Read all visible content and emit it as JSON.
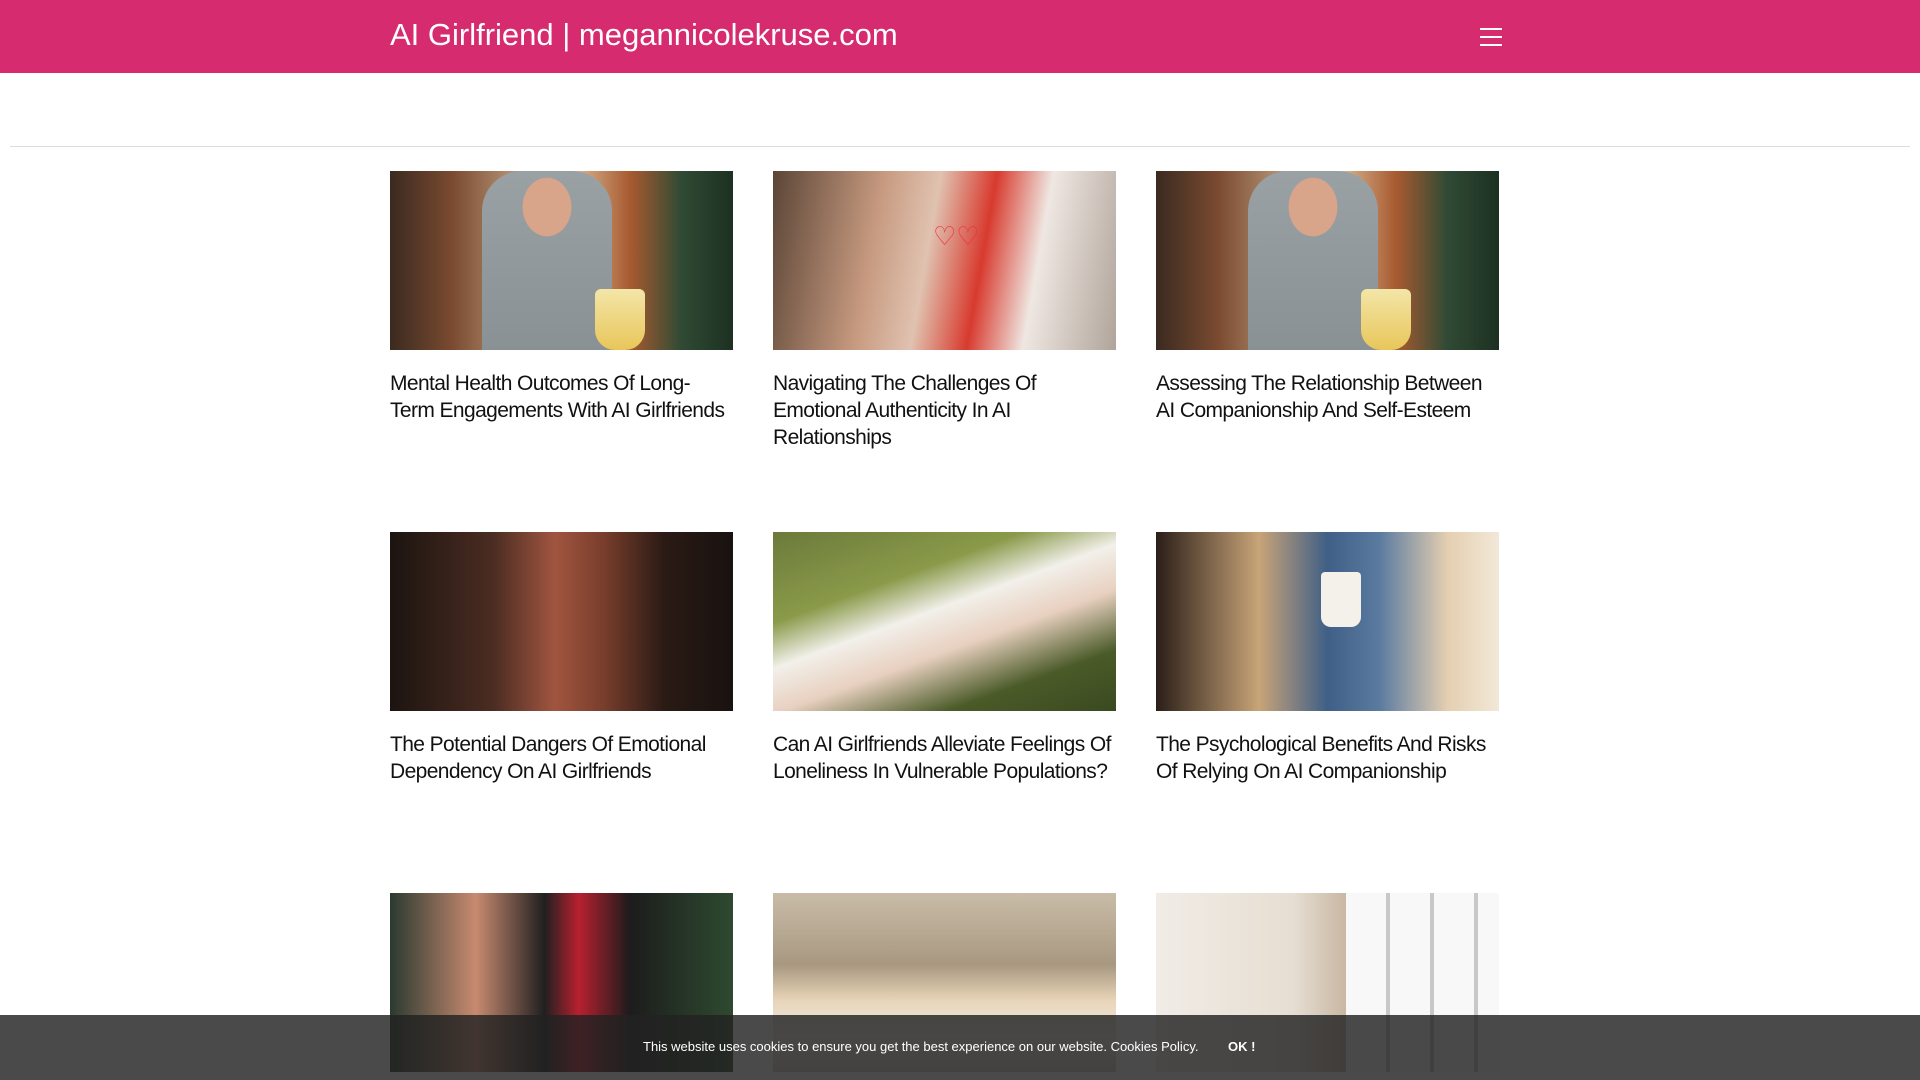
{
  "header": {
    "site_title": "AI Girlfriend | megannicolekruse.com",
    "menu_icon": "hamburger-menu-icon",
    "background_color": "#d62b6f"
  },
  "posts": [
    {
      "title": "Mental Health Outcomes Of Long-Term Engagements With AI Girlfriends"
    },
    {
      "title": "Navigating The Challenges Of Emotional Authenticity In AI Relationships"
    },
    {
      "title": "Assessing The Relationship Between AI Companionship And Self-Esteem"
    },
    {
      "title": "The Potential Dangers Of Emotional Dependency On AI Girlfriends"
    },
    {
      "title": "Can AI Girlfriends Alleviate Feelings Of Loneliness In Vulnerable Populations?"
    },
    {
      "title": "The Psychological Benefits And Risks Of Relying On AI Companionship"
    },
    {
      "title": ""
    },
    {
      "title": ""
    },
    {
      "title": ""
    }
  ],
  "cookie_banner": {
    "message": "This website uses cookies to ensure you get the best experience on our website.",
    "policy_link": "Cookies Policy.",
    "ok_label": "OK !"
  }
}
